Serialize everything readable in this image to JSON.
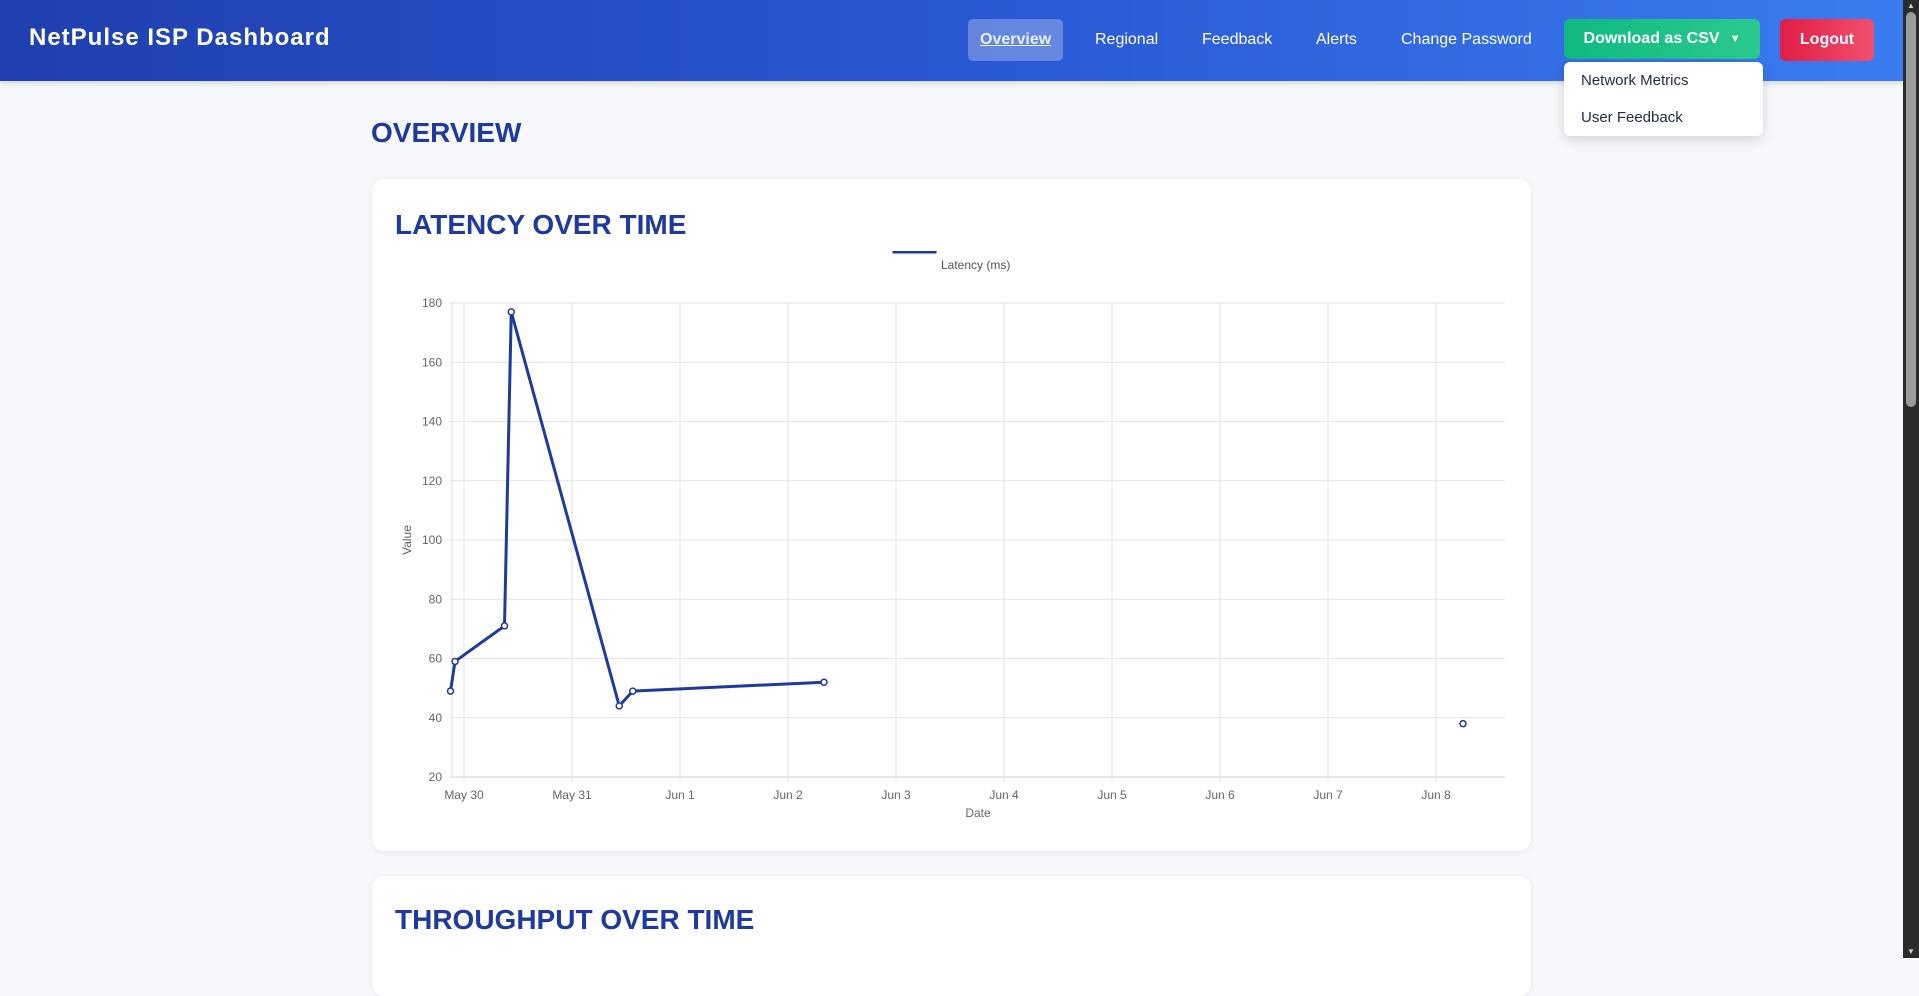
{
  "header": {
    "title": "NetPulse ISP Dashboard",
    "nav": [
      {
        "label": "Overview",
        "active": true
      },
      {
        "label": "Regional"
      },
      {
        "label": "Feedback"
      },
      {
        "label": "Alerts"
      },
      {
        "label": "Change Password"
      }
    ],
    "download_label": "Download as CSV",
    "download_icon": "caret-down-icon",
    "logout_label": "Logout",
    "download_menu": [
      "Network Metrics",
      "User Feedback"
    ]
  },
  "main": {
    "page_title": "OVERVIEW",
    "cards": [
      {
        "title": "LATENCY OVER TIME"
      },
      {
        "title": "THROUGHPUT OVER TIME"
      }
    ]
  },
  "colors": {
    "accent": "#1e3a9e",
    "series": "#1e3aa0",
    "download": "#10b981",
    "logout": "#e11d48"
  },
  "chart_data": {
    "type": "line",
    "legend": [
      "Latency (ms)"
    ],
    "legend_position": "top",
    "xlabel": "Date",
    "ylabel": "Value",
    "ylim": [
      20,
      180
    ],
    "yticks": [
      "180",
      "160",
      "140",
      "120",
      "100",
      "80",
      "60",
      "40",
      "20"
    ],
    "xticks": [
      "May 30",
      "May 31",
      "Jun 1",
      "Jun 2",
      "Jun 3",
      "Jun 4",
      "Jun 5",
      "Jun 6",
      "Jun 7",
      "Jun 8"
    ],
    "x_unit": "days",
    "grid": true,
    "series": [
      {
        "name": "Latency (ms)",
        "points": [
          {
            "x": "2025-05-29 21:00",
            "y": 49
          },
          {
            "x": "2025-05-29 22:00",
            "y": 59
          },
          {
            "x": "2025-05-30 09:00",
            "y": 71
          },
          {
            "x": "2025-05-30 10:30",
            "y": 177
          },
          {
            "x": "2025-05-31 10:30",
            "y": 44
          },
          {
            "x": "2025-05-31 13:30",
            "y": 49
          },
          {
            "x": "2025-06-02 08:00",
            "y": 52
          },
          {
            "x": "2025-06-08 06:00",
            "y": 38,
            "gap_before": true
          }
        ]
      }
    ]
  }
}
